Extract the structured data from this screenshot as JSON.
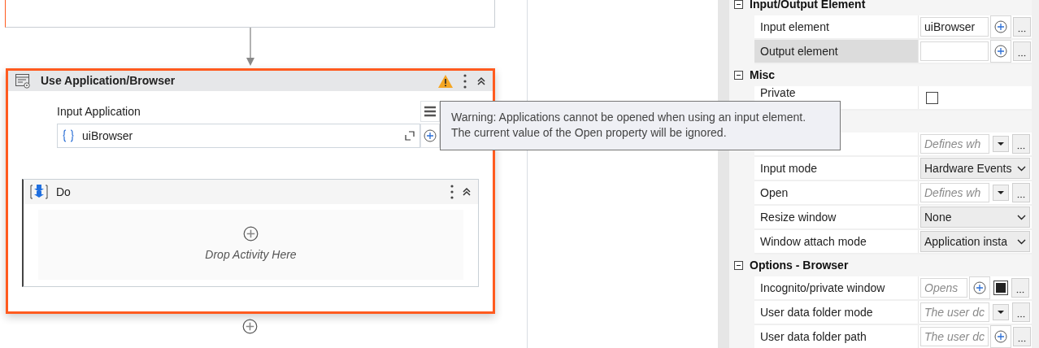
{
  "activity": {
    "title": "Use Application/Browser",
    "selected": true,
    "warning": true,
    "input_label": "Input Application",
    "input_value": "uiBrowser",
    "body": {
      "title": "Do",
      "expanded": true,
      "placeholder": "Drop Activity Here"
    }
  },
  "tooltip": {
    "lines": [
      "Warning: Applications cannot be opened when using an input element.",
      "The current value of the Open property will be ignored."
    ]
  },
  "properties": {
    "sections": [
      {
        "title": "Input/Output Element",
        "expanded": true,
        "rows": [
          {
            "name": "Input element",
            "kind": "text-plus",
            "value": "uiBrowser",
            "selected": false
          },
          {
            "name": "Output element",
            "kind": "text-plus",
            "selected": true
          }
        ]
      },
      {
        "title": "Misc",
        "expanded": true,
        "rows": [
          {
            "name": "Private",
            "kind": "checkbox",
            "checked": false,
            "selected": false
          }
        ]
      },
      {
        "rows": [
          {
            "kind": "text-dropdown",
            "placeholder": "Defines wh",
            "selected": false
          },
          {
            "name": "Input mode",
            "kind": "select",
            "value": "Hardware Events",
            "selected": false
          },
          {
            "name": "Open",
            "kind": "text-dropdown",
            "placeholder": "Defines wh",
            "selected": false
          },
          {
            "name": "Resize window",
            "kind": "select",
            "value": "None",
            "selected": false
          },
          {
            "name": "Window attach mode",
            "kind": "select",
            "value": "Application insta",
            "selected": false
          }
        ]
      },
      {
        "title": "Options - Browser",
        "expanded": true,
        "rows": [
          {
            "name": "Incognito/private window",
            "kind": "text-plus-check",
            "placeholder": "Opens",
            "checked": true,
            "selected": false
          },
          {
            "name": "User data folder mode",
            "kind": "text-dropdown",
            "placeholder": "The user dc",
            "selected": false
          },
          {
            "name": "User data folder path",
            "kind": "text-plus",
            "placeholder": "The user dc",
            "selected": false
          }
        ]
      }
    ]
  }
}
